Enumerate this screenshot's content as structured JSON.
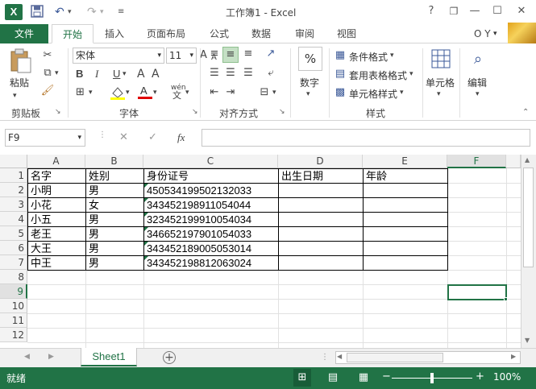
{
  "app": {
    "logo": "X",
    "title": "工作簿1 - Excel",
    "help": "?"
  },
  "quick_access": {
    "save_icon": "save-icon",
    "undo": "↶",
    "redo": "↷"
  },
  "window_controls": {
    "restore": "❐",
    "minimize": "—",
    "maximize": "☐",
    "close": "✕"
  },
  "ribbon_tabs": {
    "file": "文件",
    "home": "开始",
    "insert": "插入",
    "layout": "页面布局",
    "formulas": "公式",
    "data": "数据",
    "review": "审阅",
    "view": "视图",
    "user": "O Y"
  },
  "clipboard": {
    "paste": "粘贴",
    "label": "剪贴板"
  },
  "font": {
    "name": "宋体",
    "size": "11",
    "bold": "B",
    "italic": "I",
    "underline": "U",
    "grow": "A",
    "shrink": "A",
    "phonetic": "wén",
    "label": "字体"
  },
  "alignment": {
    "label": "对齐方式"
  },
  "number": {
    "percent": "%",
    "button": "数字"
  },
  "styles": {
    "conditional": "条件格式",
    "table": "套用表格格式",
    "cell_style": "单元格样式",
    "label": "样式"
  },
  "cells": {
    "button": "单元格"
  },
  "editing": {
    "button": "编辑"
  },
  "formula_bar": {
    "name_box": "F9",
    "cancel": "✕",
    "enter": "✓",
    "fx": "fx",
    "formula": ""
  },
  "columns": [
    "A",
    "B",
    "C",
    "D",
    "E",
    "F"
  ],
  "rows": [
    "1",
    "2",
    "3",
    "4",
    "5",
    "6",
    "7",
    "8",
    "9",
    "10",
    "11",
    "12"
  ],
  "table": {
    "headers": [
      "名字",
      "姓别",
      "身份证号",
      "出生日期",
      "年龄"
    ],
    "rows": [
      [
        "小明",
        "男",
        "450534199502132033"
      ],
      [
        "小花",
        "女",
        "343452198911054044"
      ],
      [
        "小五",
        "男",
        "323452199910054034"
      ],
      [
        "老王",
        "男",
        "346652197901054033"
      ],
      [
        "大王",
        "男",
        "343452189005053014"
      ],
      [
        "中王",
        "男",
        "343452198812063024"
      ]
    ]
  },
  "sheets": {
    "active": "Sheet1",
    "add": "+"
  },
  "status": {
    "mode": "就绪",
    "zoom": "100%",
    "zoom_out": "−",
    "zoom_in": "+"
  },
  "colors": {
    "accent": "#217346",
    "selection": "#217346"
  }
}
